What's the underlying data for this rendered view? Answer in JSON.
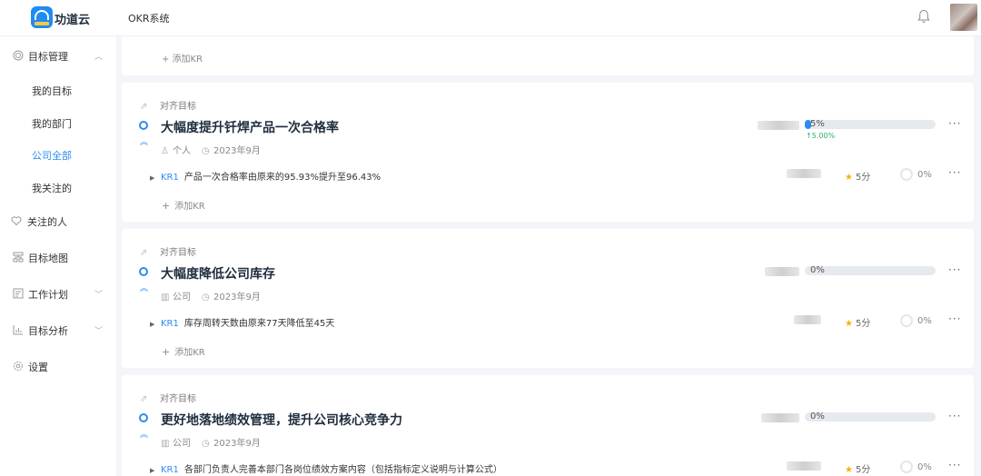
{
  "header": {
    "brand": "功道云",
    "system": "OKR系统",
    "icons": [
      "logo-icon",
      "bell-icon",
      "avatar"
    ]
  },
  "sidebar": {
    "goal_mgmt": "目标管理",
    "sub_items": [
      "我的目标",
      "我的部门",
      "公司全部",
      "我关注的"
    ],
    "active_sub": "公司全部",
    "items": [
      "关注的人",
      "目标地图",
      "工作计划",
      "目标分析",
      "设置"
    ]
  },
  "main": {
    "top_add_kr": "+ 添加KR",
    "objectives": [
      {
        "align_label": "对齐目标",
        "title": "大幅度提升钎焊产品一次合格率",
        "owner_type": "个人",
        "period": "2023年9月",
        "progress_text": "5%",
        "progress_value": 0.05,
        "delta": "↑5.00%",
        "krs": [
          {
            "id": "KR1",
            "text": "产品一次合格率由原来的95.93%提升至96.43%",
            "score": "5分",
            "progress": "0%"
          }
        ],
        "add_kr": "添加KR"
      },
      {
        "align_label": "对齐目标",
        "title": "大幅度降低公司库存",
        "owner_type": "公司",
        "period": "2023年9月",
        "progress_text": "0%",
        "progress_value": 0,
        "krs": [
          {
            "id": "KR1",
            "text": "库存周转天数由原来77天降低至45天",
            "score": "5分",
            "progress": "0%"
          }
        ],
        "add_kr": "添加KR"
      },
      {
        "align_label": "对齐目标",
        "title": "更好地落地绩效管理，提升公司核心竞争力",
        "owner_type": "公司",
        "period": "2023年9月",
        "progress_text": "0%",
        "progress_value": 0,
        "krs": [
          {
            "id": "KR1",
            "text": "各部门负责人完善本部门各岗位绩效方案内容（包括指标定义说明与计算公式）",
            "score": "5分",
            "progress": "0%"
          }
        ]
      }
    ]
  },
  "colors": {
    "accent": "#2d8cf0",
    "delta_green": "#27b36a",
    "star": "#f5b400"
  }
}
